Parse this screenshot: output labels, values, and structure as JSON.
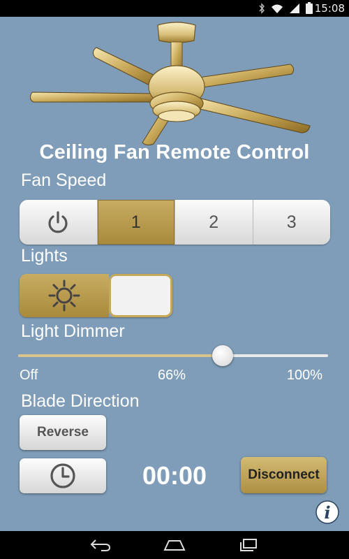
{
  "status_bar": {
    "time": "15:08",
    "icons": [
      "bluetooth-icon",
      "wifi-icon",
      "signal-icon",
      "battery-icon"
    ]
  },
  "app": {
    "title": "Ceiling Fan Remote Control",
    "colors": {
      "background": "#7f9db8",
      "gold": "#b89a4c",
      "text": "#ffffff"
    }
  },
  "fan_speed": {
    "label": "Fan Speed",
    "options": [
      {
        "id": "power",
        "label": "",
        "icon": "power-icon"
      },
      {
        "id": "1",
        "label": "1"
      },
      {
        "id": "2",
        "label": "2"
      },
      {
        "id": "3",
        "label": "3"
      }
    ],
    "selected": "1"
  },
  "lights": {
    "label": "Lights",
    "icon": "sun-icon",
    "state": "on"
  },
  "dimmer": {
    "label": "Light Dimmer",
    "value_percent": 66,
    "min_label": "Off",
    "mid_label": "66%",
    "max_label": "100%"
  },
  "blade_direction": {
    "label": "Blade Direction",
    "button_label": "Reverse"
  },
  "timer": {
    "icon": "clock-icon",
    "value": "00:00"
  },
  "connection": {
    "button_label": "Disconnect"
  },
  "info": {
    "icon": "info-icon"
  },
  "nav_bar": {
    "items": [
      "back-icon",
      "home-icon",
      "recent-apps-icon"
    ]
  }
}
